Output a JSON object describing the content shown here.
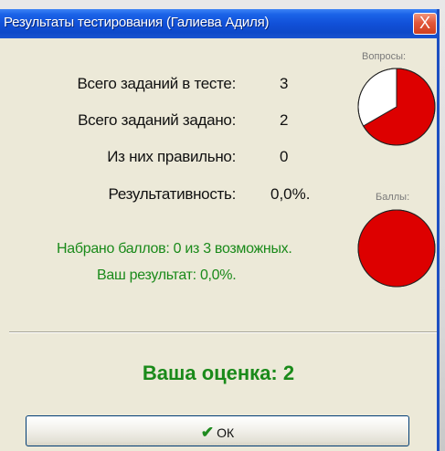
{
  "window": {
    "title": "Результаты тестирования (Галиева Адиля)",
    "close_glyph": "X"
  },
  "stats": [
    {
      "label": "Всего заданий в тесте:",
      "value": "3"
    },
    {
      "label": "Всего заданий задано:",
      "value": "2"
    },
    {
      "label": "Из них правильно:",
      "value": "0"
    },
    {
      "label": "Результативность:",
      "value": "0,0%."
    }
  ],
  "charts": {
    "questions_caption": "Вопросы:",
    "points_caption": "Баллы:"
  },
  "summary": {
    "points_line": "Набрано баллов: 0 из 3 возможных.",
    "result_line": "Ваш результат: 0,0%."
  },
  "grade_text": "Ваша оценка: 2",
  "ok_button": {
    "label": "ОК",
    "icon": "checkmark-icon"
  },
  "chart_data": [
    {
      "type": "pie",
      "title": "Вопросы:",
      "categories": [
        "asked",
        "not asked"
      ],
      "values": [
        2,
        1
      ],
      "colors": [
        "#dd0000",
        "#ffffff"
      ]
    },
    {
      "type": "pie",
      "title": "Баллы:",
      "categories": [
        "lost",
        "earned"
      ],
      "values": [
        3,
        0
      ],
      "colors": [
        "#dd0000",
        "#ffffff"
      ]
    }
  ],
  "colors": {
    "title_bar": "#1150d8",
    "pie_red": "#dd0000",
    "green_text": "#1a8a1a",
    "dialog_bg": "#ece9d8"
  }
}
